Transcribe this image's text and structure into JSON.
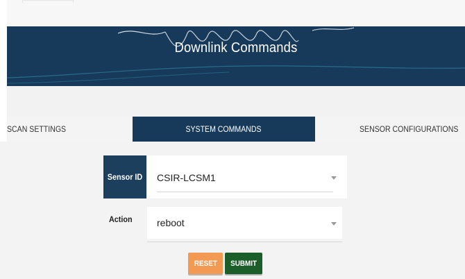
{
  "header": {
    "title": "Downlink Commands"
  },
  "tabs": [
    {
      "label": "SCAN SETTINGS",
      "active": false
    },
    {
      "label": "SYSTEM COMMANDS",
      "active": true
    },
    {
      "label": "SENSOR CONFIGURATIONS",
      "active": false
    }
  ],
  "form": {
    "sensor_id_label": "Sensor ID",
    "sensor_id_value": "CSIR-LCSM1",
    "action_label": "Action",
    "action_value": "reboot"
  },
  "buttons": {
    "reset_label": "RESET",
    "submit_label": "SUBMIT"
  },
  "colors": {
    "banner": "#173a5a",
    "active_tab": "#173a5a",
    "reset": "#f29a54",
    "submit": "#1b5e2a"
  },
  "icons": {
    "dropdown": "chevron-down-icon"
  }
}
